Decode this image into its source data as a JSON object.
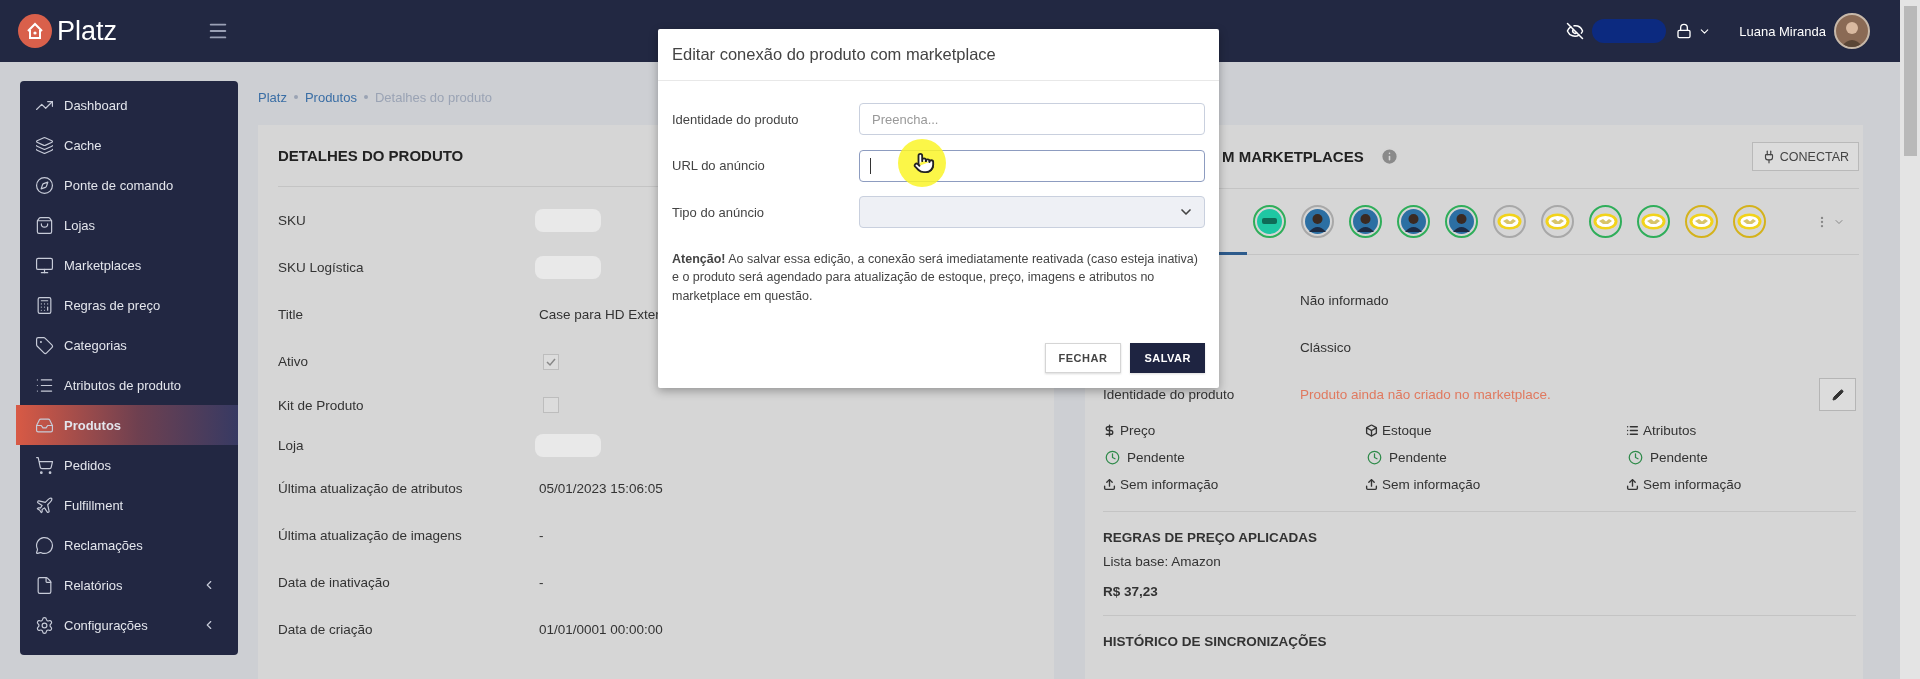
{
  "topbar": {
    "brand": "Platz",
    "user_name": "Luana Miranda"
  },
  "sidebar": {
    "items": [
      {
        "label": "Dashboard",
        "selected": false,
        "has_submenu": false
      },
      {
        "label": "Cache",
        "selected": false,
        "has_submenu": false
      },
      {
        "label": "Ponte de comando",
        "selected": false,
        "has_submenu": false
      },
      {
        "label": "Lojas",
        "selected": false,
        "has_submenu": false
      },
      {
        "label": "Marketplaces",
        "selected": false,
        "has_submenu": false
      },
      {
        "label": "Regras de preço",
        "selected": false,
        "has_submenu": false
      },
      {
        "label": "Categorias",
        "selected": false,
        "has_submenu": false
      },
      {
        "label": "Atributos de produto",
        "selected": false,
        "has_submenu": false
      },
      {
        "label": "Produtos",
        "selected": true,
        "has_submenu": false
      },
      {
        "label": "Pedidos",
        "selected": false,
        "has_submenu": false
      },
      {
        "label": "Fulfillment",
        "selected": false,
        "has_submenu": false
      },
      {
        "label": "Reclamações",
        "selected": false,
        "has_submenu": false
      },
      {
        "label": "Relatórios",
        "selected": false,
        "has_submenu": true
      },
      {
        "label": "Configurações",
        "selected": false,
        "has_submenu": true
      }
    ]
  },
  "breadcrumb": [
    {
      "label": "Platz",
      "current": false
    },
    {
      "label": "Produtos",
      "current": false
    },
    {
      "label": "Detalhes do produto",
      "current": true
    }
  ],
  "product_details": {
    "title": "DETALHES DO PRODUTO",
    "rows": [
      {
        "label": "SKU",
        "kind": "hidden"
      },
      {
        "label": "SKU Logística",
        "kind": "hidden"
      },
      {
        "label": "Title",
        "kind": "text",
        "value": "Case para HD Exter"
      },
      {
        "label": "Ativo",
        "kind": "checkbox",
        "checked": true
      },
      {
        "label": "Kit de Produto",
        "kind": "checkbox",
        "checked": false
      },
      {
        "label": "Loja",
        "kind": "hidden"
      },
      {
        "label": "Última atualização de atributos",
        "kind": "text",
        "value": "05/01/2023 15:06:05"
      },
      {
        "label": "Última atualização de imagens",
        "kind": "text",
        "value": "-"
      },
      {
        "label": "Data de inativação",
        "kind": "text",
        "value": "-"
      },
      {
        "label": "Data de criação",
        "kind": "text",
        "value": "01/01/0001 00:00:00"
      }
    ]
  },
  "marketplaces_panel": {
    "title": "M MARKETPLACES",
    "connect_button": "CONECTAR",
    "marketplaces": [
      {
        "kind": "b2w",
        "color": "#2fae5a"
      },
      {
        "kind": "avatar",
        "color": "#a8a8a8"
      },
      {
        "kind": "avatar",
        "color": "#2fae5a"
      },
      {
        "kind": "avatar",
        "color": "#2fae5a"
      },
      {
        "kind": "avatar",
        "color": "#2fae5a"
      },
      {
        "kind": "handshake",
        "color": "#a8a8a8"
      },
      {
        "kind": "handshake",
        "color": "#a8a8a8"
      },
      {
        "kind": "handshake",
        "color": "#2fae5a"
      },
      {
        "kind": "handshake",
        "color": "#2fae5a"
      },
      {
        "kind": "handshake",
        "color": "#d4b21c"
      },
      {
        "kind": "handshake",
        "color": "#d4b21c"
      }
    ],
    "details": [
      {
        "value": "Não informado",
        "kind": "normal"
      },
      {
        "value": "Clássico",
        "kind": "normal"
      },
      {
        "label": "Identidade do produto",
        "value": "Produto ainda não criado no marketplace.",
        "kind": "warning"
      }
    ],
    "sync": [
      {
        "title": "Preço",
        "status": "Pendente",
        "info": "Sem informação"
      },
      {
        "title": "Estoque",
        "status": "Pendente",
        "info": "Sem informação"
      },
      {
        "title": "Atributos",
        "status": "Pendente",
        "info": "Sem informação"
      }
    ],
    "price_rules": {
      "title": "REGRAS DE PREÇO APLICADAS",
      "base_list": "Lista base: Amazon",
      "price": "R$ 37,23"
    },
    "history_title": "HISTÓRICO DE SINCRONIZAÇÕES"
  },
  "modal": {
    "title": "Editar conexão do produto com marketplace",
    "fields": [
      {
        "label": "Identidade do produto",
        "kind": "input",
        "placeholder": "Preencha...",
        "focused": false
      },
      {
        "label": "URL do anúncio",
        "kind": "input",
        "focused": true
      },
      {
        "label": "Tipo do anúncio",
        "kind": "select"
      }
    ],
    "notice": "**Atenção!** Ao salvar essa edição, a conexão será imediatamente reativada (caso esteja inativa) e o produto será agendado para atualização de estoque, preço, imagens e atributos no marketplace em questão.",
    "buttons": [
      {
        "label": "FECHAR",
        "kind": "secondary"
      },
      {
        "label": "SALVAR",
        "kind": "primary"
      }
    ]
  }
}
